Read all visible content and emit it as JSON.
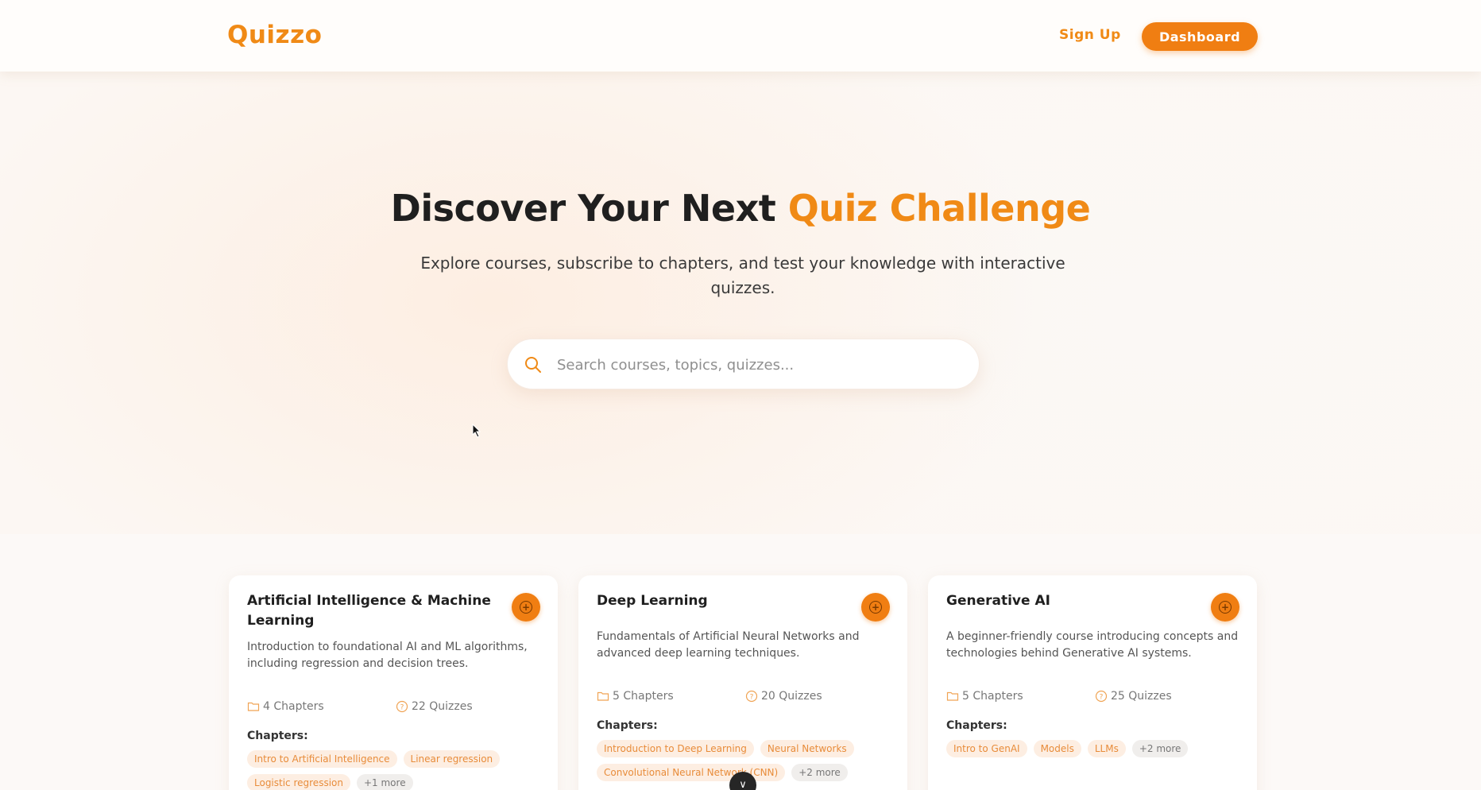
{
  "nav": {
    "logo": "Quizzo",
    "signup_label": "Sign Up",
    "dashboard_label": "Dashboard"
  },
  "hero": {
    "title_main": "Discover Your Next ",
    "title_accent": "Quiz Challenge",
    "subtitle": "Explore courses, subscribe to chapters, and test your knowledge with interactive quizzes.",
    "search_placeholder": "Search courses, topics, quizzes..."
  },
  "colors": {
    "accent": "#f08a16",
    "button": "#f07e12",
    "chip_bg": "#fdeee2"
  },
  "cards": [
    {
      "title": "Artificial Intelligence & Machine Learning",
      "description": "Introduction to foundational AI and ML algorithms, including regression and decision trees.",
      "chapters": "4 Chapters",
      "quizzes": "22 Quizzes",
      "chapters_label": "Chapters:",
      "chips": [
        "Intro to Artificial Intelligence",
        "Linear regression",
        "Logistic regression",
        "+1 more"
      ]
    },
    {
      "title": "Deep Learning",
      "description": "Fundamentals of Artificial Neural Networks and advanced deep learning techniques.",
      "chapters": "5 Chapters",
      "quizzes": "20 Quizzes",
      "chapters_label": "Chapters:",
      "chips": [
        "Introduction to Deep Learning",
        "Neural Networks",
        "Convolutional Neural Network (CNN)",
        "+2 more"
      ]
    },
    {
      "title": "Generative AI",
      "description": "A beginner-friendly course introducing concepts and technologies behind Generative AI systems.",
      "chapters": "5 Chapters",
      "quizzes": "25 Quizzes",
      "chapters_label": "Chapters:",
      "chips": [
        "Intro to GenAI",
        "Models",
        "LLMs",
        "+2 more"
      ]
    }
  ],
  "scroll_button_glyph": "∨"
}
